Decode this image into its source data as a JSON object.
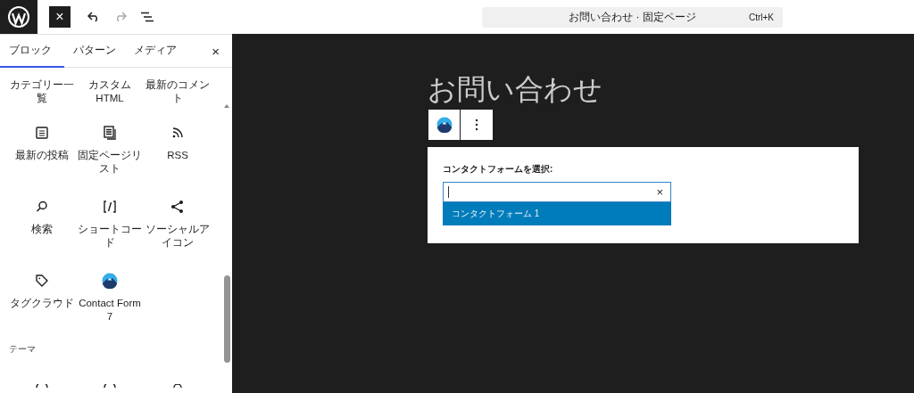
{
  "topbar": {
    "close_button": "×",
    "undo": {
      "disabled": false
    },
    "redo": {
      "disabled": true
    },
    "command_bar": {
      "title": "お問い合わせ · 固定ページ",
      "shortcut": "Ctrl+K"
    }
  },
  "sidebar": {
    "tabs": [
      {
        "label": "ブロック",
        "selected": true
      },
      {
        "label": "パターン",
        "selected": false
      },
      {
        "label": "メディア",
        "selected": false
      }
    ],
    "close": "×",
    "blocks": [
      {
        "label": "カテゴリー一覧"
      },
      {
        "label": "カスタム HTML"
      },
      {
        "label": "最新のコメント"
      },
      {
        "label": "最新の投稿"
      },
      {
        "label": "固定ページリスト"
      },
      {
        "label": "RSS"
      },
      {
        "label": "検索"
      },
      {
        "label": "ショートコード"
      },
      {
        "label": "ソーシャルアイコン"
      },
      {
        "label": "タグクラウド"
      },
      {
        "label": "Contact Form 7"
      }
    ],
    "section": "テーマ"
  },
  "canvas": {
    "title": "お問い合わせ",
    "form_block": {
      "label": "コンタクトフォームを選択:",
      "clear": "×",
      "options": [
        {
          "label": "コンタクトフォーム 1",
          "selected": true
        }
      ]
    }
  }
}
